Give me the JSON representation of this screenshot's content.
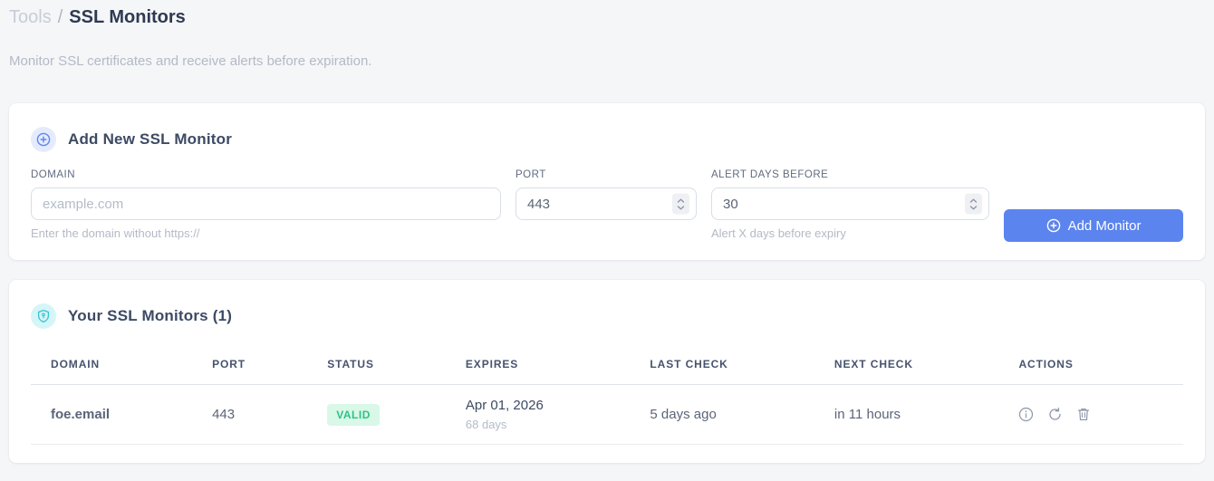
{
  "page": {
    "breadcrumb": {
      "section": "Tools",
      "separator": "/",
      "current": "SSL Monitors"
    },
    "subtitle": "Monitor SSL certificates and receive alerts before expiration."
  },
  "add_monitor_card": {
    "title": "Add New SSL Monitor",
    "header_icon": "plus-circle-icon",
    "fields": {
      "domain": {
        "label": "DOMAIN",
        "placeholder": "example.com",
        "value": "",
        "hint": "Enter the domain without https://"
      },
      "port": {
        "label": "PORT",
        "value": "443"
      },
      "alert_days": {
        "label": "ALERT DAYS BEFORE",
        "value": "30",
        "hint": "Alert X days before expiry"
      }
    },
    "submit_label": "Add Monitor",
    "submit_icon": "plus-circle-icon"
  },
  "monitors_card": {
    "title": "Your SSL Monitors (1)",
    "header_icon": "shield-icon",
    "table": {
      "headers": [
        "DOMAIN",
        "PORT",
        "STATUS",
        "EXPIRES",
        "LAST CHECK",
        "NEXT CHECK",
        "ACTIONS"
      ],
      "rows": [
        {
          "domain": "foe.email",
          "port": "443",
          "status": "VALID",
          "expires_date": "Apr 01, 2026",
          "expires_days": "68 days",
          "last_check": "5 days ago",
          "next_check": "in 11 hours",
          "action_icons": [
            "info-icon",
            "refresh-icon",
            "trash-icon"
          ]
        }
      ]
    }
  },
  "colors": {
    "accent_blue": "#5b84ee",
    "link_blue": "#5b86ee",
    "valid_bg": "#d9f8e8",
    "valid_text": "#2dc384",
    "cyan_icon": "#35c3d6",
    "page_bg": "#f5f6f8"
  }
}
